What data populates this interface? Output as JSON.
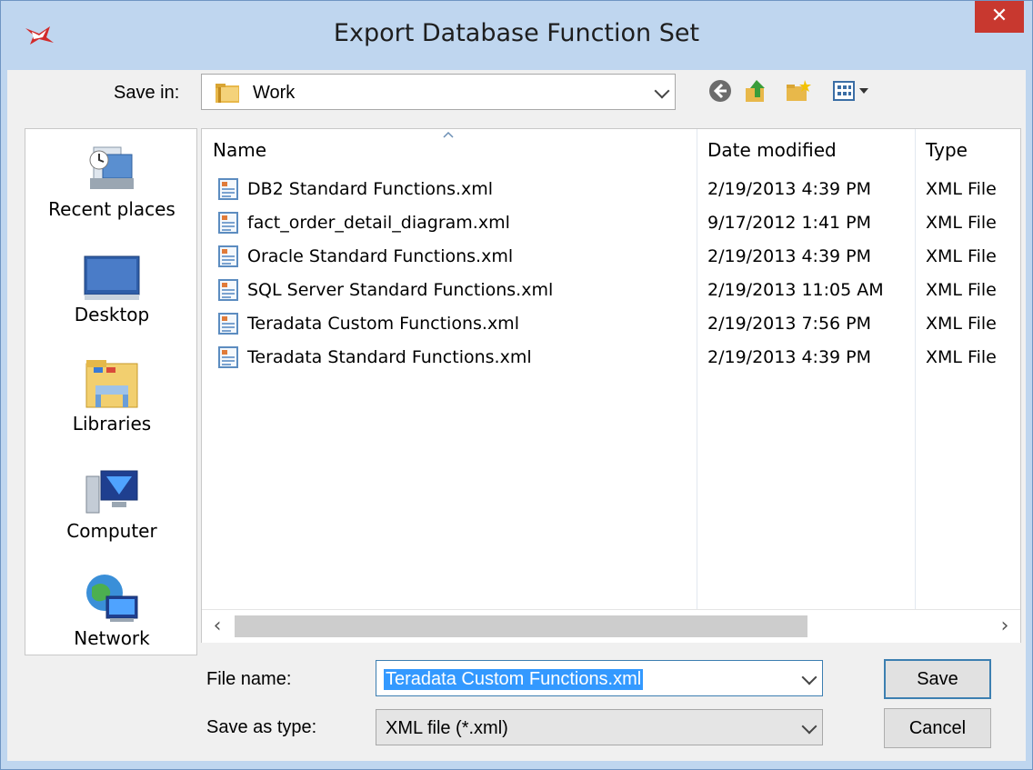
{
  "window": {
    "title": "Export Database Function Set",
    "close_glyph": "✕"
  },
  "save_in": {
    "label": "Save in:",
    "value": "Work"
  },
  "toolbar": {
    "icons": [
      "back-icon",
      "up-folder-icon",
      "new-folder-icon",
      "view-menu-icon"
    ]
  },
  "places": [
    {
      "label": "Recent places",
      "icon": "recent-places-icon"
    },
    {
      "label": "Desktop",
      "icon": "desktop-icon"
    },
    {
      "label": "Libraries",
      "icon": "libraries-icon"
    },
    {
      "label": "Computer",
      "icon": "computer-icon"
    },
    {
      "label": "Network",
      "icon": "network-icon"
    }
  ],
  "file_list": {
    "columns": [
      "Name",
      "Date modified",
      "Type"
    ],
    "rows": [
      {
        "name": "DB2 Standard Functions.xml",
        "date": "2/19/2013 4:39 PM",
        "type": "XML File"
      },
      {
        "name": "fact_order_detail_diagram.xml",
        "date": "9/17/2012 1:41 PM",
        "type": "XML File"
      },
      {
        "name": "Oracle Standard Functions.xml",
        "date": "2/19/2013 4:39 PM",
        "type": "XML File"
      },
      {
        "name": "SQL Server Standard Functions.xml",
        "date": "2/19/2013 11:05 AM",
        "type": "XML File"
      },
      {
        "name": "Teradata Custom Functions.xml",
        "date": "2/19/2013 7:56 PM",
        "type": "XML File"
      },
      {
        "name": "Teradata Standard Functions.xml",
        "date": "2/19/2013 4:39 PM",
        "type": "XML File"
      }
    ],
    "scroll_left": "‹",
    "scroll_right": "›"
  },
  "file_name": {
    "label": "File name:",
    "value": "Teradata Custom Functions.xml"
  },
  "save_as_type": {
    "label": "Save as type:",
    "value": "XML file (*.xml)"
  },
  "buttons": {
    "save": "Save",
    "cancel": "Cancel"
  },
  "colors": {
    "title_bg": "#bfd6ef",
    "close_bg": "#c8382f",
    "selection": "#3399ff",
    "client_bg": "#f0f0f0"
  }
}
